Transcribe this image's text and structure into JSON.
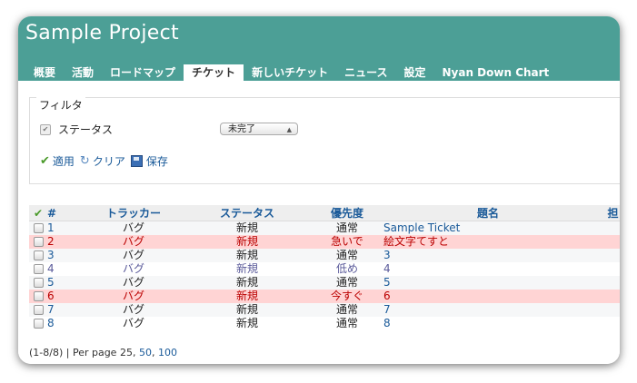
{
  "project": {
    "title": "Sample Project"
  },
  "colors": {
    "header": "#4c9f96",
    "link": "#1a5a99",
    "urgent_bg": "#ffd4d4",
    "urgent_text": "#b00000"
  },
  "tabs": [
    {
      "label": "概要",
      "selected": false
    },
    {
      "label": "活動",
      "selected": false
    },
    {
      "label": "ロードマップ",
      "selected": false
    },
    {
      "label": "チケット",
      "selected": true
    },
    {
      "label": "新しいチケット",
      "selected": false
    },
    {
      "label": "ニュース",
      "selected": false
    },
    {
      "label": "設定",
      "selected": false
    },
    {
      "label": "Nyan Down Chart",
      "selected": false
    }
  ],
  "filter": {
    "legend": "フィルタ",
    "status_label": "ステータス",
    "status_value": "未完了",
    "apply_label": "適用",
    "clear_label": "クリア",
    "save_label": "保存"
  },
  "table": {
    "headers": {
      "check": "✔",
      "id": "#",
      "tracker": "トラッカー",
      "status": "ステータス",
      "priority": "優先度",
      "subject": "題名",
      "assignee": "担"
    },
    "rows": [
      {
        "id": "1",
        "tracker": "バグ",
        "status": "新規",
        "priority": "通常",
        "subject": "Sample Ticket",
        "style": "odd"
      },
      {
        "id": "2",
        "tracker": "バグ",
        "status": "新規",
        "priority": "急いで",
        "subject": "絵文字てすと",
        "style": "urgent"
      },
      {
        "id": "3",
        "tracker": "バグ",
        "status": "新規",
        "priority": "通常",
        "subject": "3",
        "style": "odd"
      },
      {
        "id": "4",
        "tracker": "バグ",
        "status": "新規",
        "priority": "低め",
        "subject": "4",
        "style": "low"
      },
      {
        "id": "5",
        "tracker": "バグ",
        "status": "新規",
        "priority": "通常",
        "subject": "5",
        "style": "odd"
      },
      {
        "id": "6",
        "tracker": "バグ",
        "status": "新規",
        "priority": "今すぐ",
        "subject": "6",
        "style": "urgent"
      },
      {
        "id": "7",
        "tracker": "バグ",
        "status": "新規",
        "priority": "通常",
        "subject": "7",
        "style": "odd"
      },
      {
        "id": "8",
        "tracker": "バグ",
        "status": "新規",
        "priority": "通常",
        "subject": "8",
        "style": "even"
      }
    ]
  },
  "pagination": {
    "summary": "(1-8/8) | Per page 25,",
    "opt1": "50",
    "sep": ",",
    "opt2": "100"
  }
}
